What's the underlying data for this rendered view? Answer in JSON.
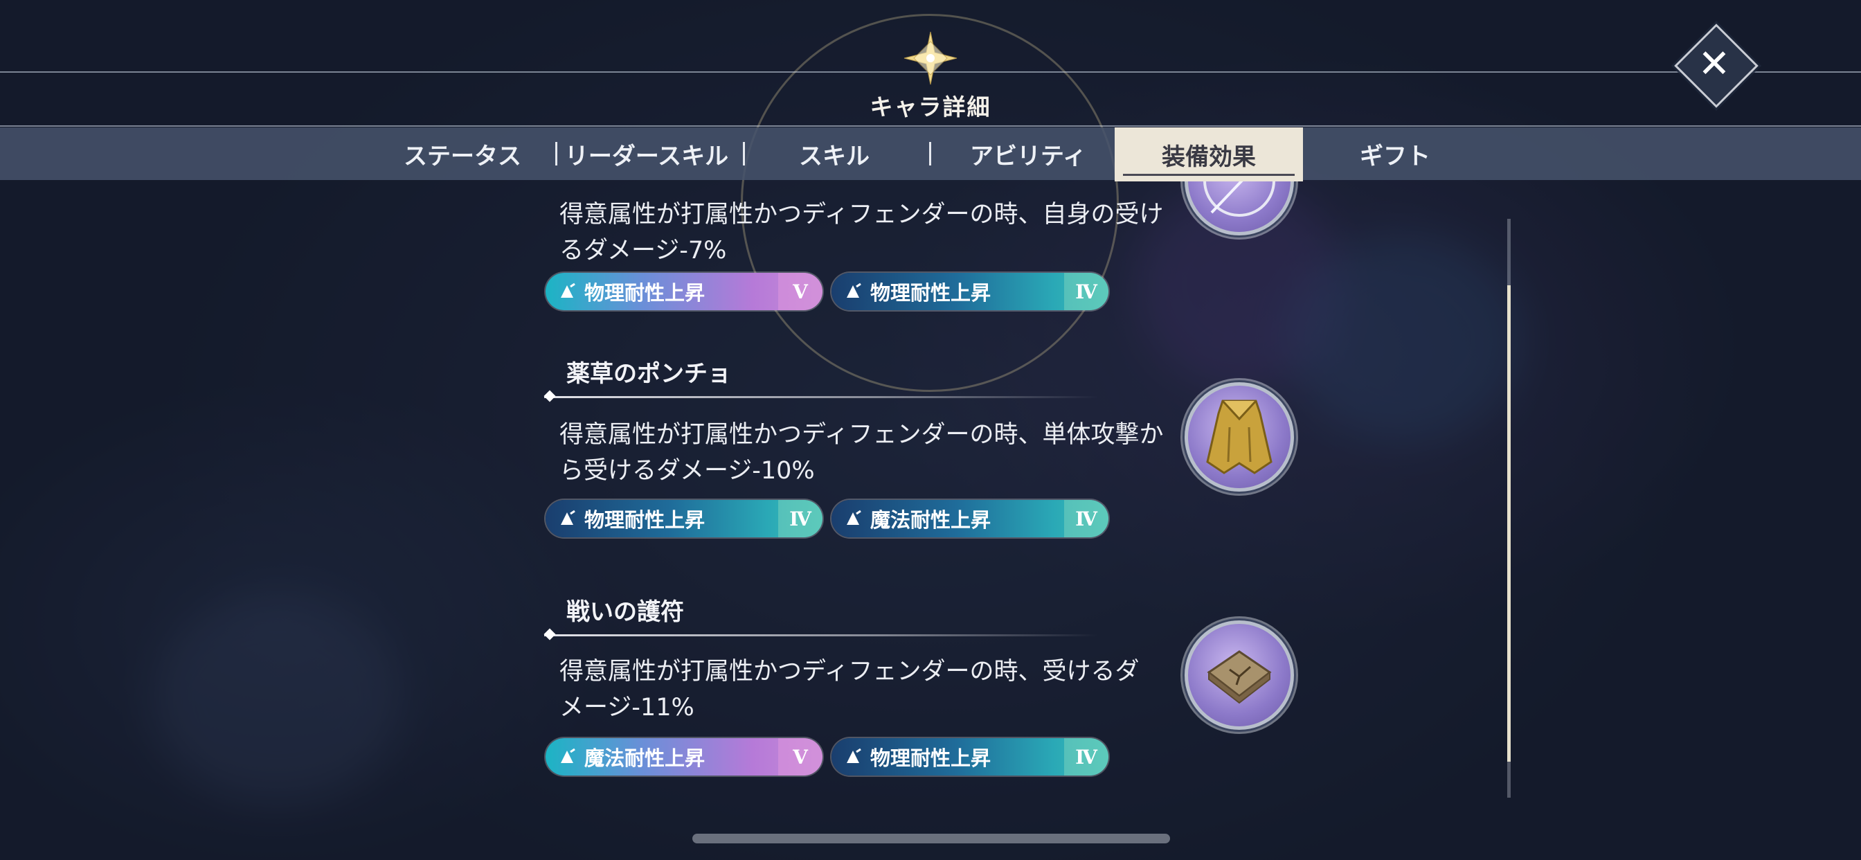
{
  "header": {
    "title": "キャラ詳細",
    "close_icon": "close-icon"
  },
  "tabs": [
    {
      "label": "ステータス",
      "active": false
    },
    {
      "label": "リーダースキル",
      "active": false
    },
    {
      "label": "スキル",
      "active": false
    },
    {
      "label": "アビリティ",
      "active": false
    },
    {
      "label": "装備効果",
      "active": true
    },
    {
      "label": "ギフト",
      "active": false
    }
  ],
  "equipment": [
    {
      "name": "",
      "description_lines": [
        "得意属性が打属性かつディフェンダーの時、自身の受け",
        "るダメージ-7%"
      ],
      "icon": "shield-orb-icon",
      "badges": [
        {
          "label": "物理耐性上昇",
          "rank": "V",
          "style": "purple"
        },
        {
          "label": "物理耐性上昇",
          "rank": "Ⅳ",
          "style": "teal"
        }
      ]
    },
    {
      "name": "薬草のポンチョ",
      "description_lines": [
        "得意属性が打属性かつディフェンダーの時、単体攻撃か",
        "ら受けるダメージ-10%"
      ],
      "icon": "poncho-icon",
      "badges": [
        {
          "label": "物理耐性上昇",
          "rank": "Ⅳ",
          "style": "teal"
        },
        {
          "label": "魔法耐性上昇",
          "rank": "Ⅳ",
          "style": "teal"
        }
      ]
    },
    {
      "name": "戦いの護符",
      "description_lines": [
        "得意属性が打属性かつディフェンダーの時、受けるダ",
        "メージ-11%"
      ],
      "icon": "talisman-icon",
      "badges": [
        {
          "label": "魔法耐性上昇",
          "rank": "V",
          "style": "purple"
        },
        {
          "label": "物理耐性上昇",
          "rank": "Ⅳ",
          "style": "teal"
        }
      ]
    }
  ],
  "colors": {
    "tab_active_bg": "#ece6d8",
    "tab_bar_bg": "#46546c",
    "badge_purple": "#b67ad8",
    "badge_teal": "#1f6c9a"
  }
}
